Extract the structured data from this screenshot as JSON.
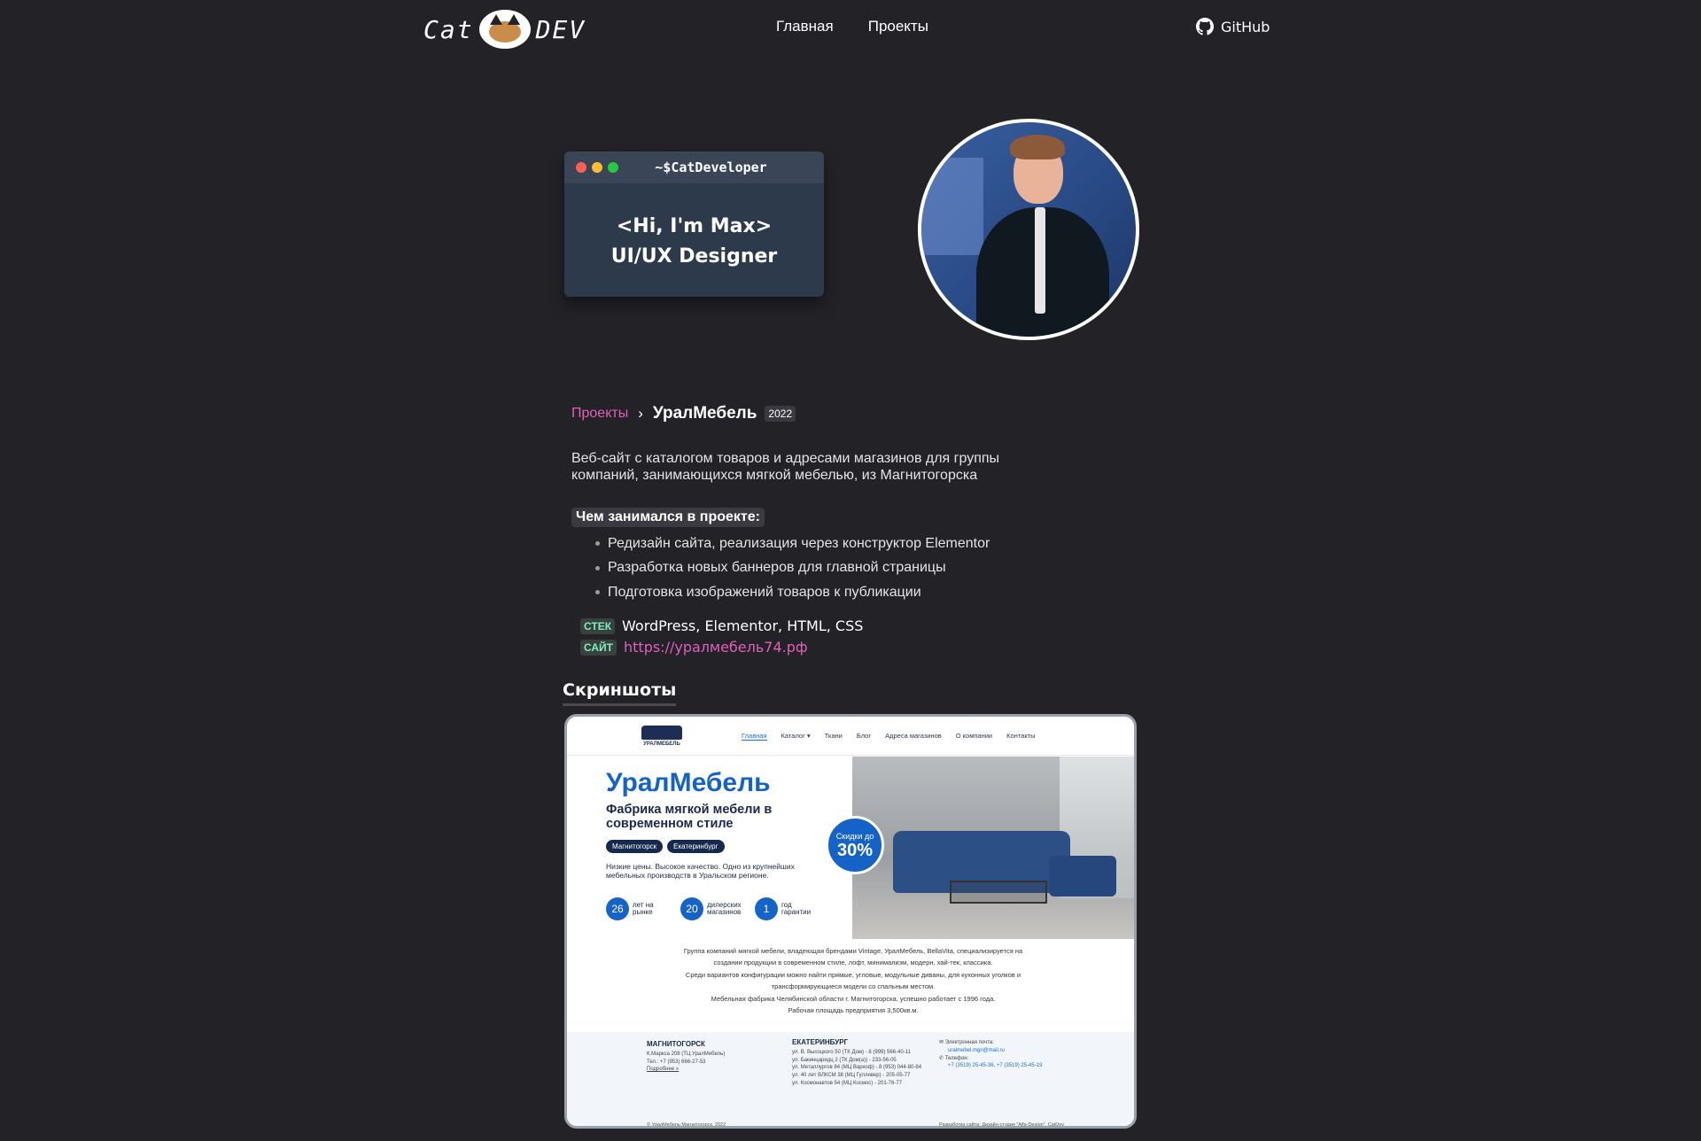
{
  "header": {
    "logo_left": "Cat",
    "logo_right": "DEV",
    "nav": [
      {
        "label": "Главная"
      },
      {
        "label": "Проекты"
      }
    ],
    "github_label": "GitHub"
  },
  "hero": {
    "terminal_title": "~$CatDeveloper",
    "greeting": "<Hi, I'm Max>",
    "role": "UI/UX Designer"
  },
  "project": {
    "breadcrumb_link": "Проекты",
    "breadcrumb_sep": "›",
    "title": "УралМебель",
    "year": "2022",
    "description": "Веб-сайт с каталогом товаров и адресами магазинов для группы компаний, занимающихся мягкой мебелью, из Магнитогорска",
    "role_heading": "Чем занимался в проекте:",
    "tasks": [
      "Редизайн сайта, реализация через конструктор Elementor",
      "Разработка новых баннеров для главной страницы",
      "Подготовка изображений товаров к публикации"
    ],
    "stack_tag": "СТЕК",
    "stack_value": "WordPress, Elementor, HTML, CSS",
    "site_tag": "САЙТ",
    "site_value": "https://уралмебель74.рф",
    "screenshots_heading": "Скриншоты"
  },
  "screenshot": {
    "logo_text": "УРАЛМЕБЕЛЬ",
    "nav": [
      "Главная",
      "Каталог ▾",
      "Ткани",
      "Блог",
      "Адреса магазинов",
      "О компании",
      "Контакты"
    ],
    "brand": "УралМебель",
    "tagline": "Фабрика мягкой мебели в современном стиле",
    "cities": [
      "Магнитогорск",
      "Екатеринбург"
    ],
    "subtitle": "Низкие цены. Высокое качество. Одно из крупнейших мебельных производств в Уральском регионе.",
    "stats": [
      {
        "num": "26",
        "label": "лет на рынке"
      },
      {
        "num": "20",
        "label": "дилерских магазинов"
      },
      {
        "num": "1",
        "label": "год гарантии"
      }
    ],
    "badge_top": "Скидки до",
    "badge_value": "30%",
    "about_lines": [
      "Группа компаний мягкой мебели, владеющая брендами Vintage, УралМебель, BellaVita, специализируется на",
      "создании продукции в современном стиле, лофт, минимализм, модерн, хай-тек, классика.",
      "Среди вариантов конфигурации можно найти прямые, угловые, модульные диваны, для кухонных уголков и",
      "трансформирующиеся модели со спальным местом.",
      "Мебельная фабрика Челябинской области г. Магнитогорска, успешно работает с 1996 года.",
      "Рабочая площадь предприятия 3,500кв.м."
    ],
    "footer_city1": "МАГНИТОГОРСК",
    "footer_city1_lines": [
      "К.Маркса 208 (ТЦ УралМебель)",
      "Тел.: +7 (953) 666-27-53",
      "",
      "Подробнее »"
    ],
    "footer_city2": "ЕКАТЕРИНБУРГ",
    "footer_city2_lines": [
      "ул. В. Высоцкого 50 (ТК Дом) - 8 (999) 566-40-11",
      "ул. Бакинцаридц 2 (ТК Дом(а)) - 233-56-05",
      "ул. Металлургов 84 (МЦ Вархоф) - 8 (953) 044-80-84",
      "ул. 40 лет ВЛКСМ 38 (МЦ Гулливер) - 205-05-77",
      "ул. Космонавтов 54 (МЦ Космос) - 201-76-77"
    ],
    "footer_email_label": "Электронная почта:",
    "footer_email": "uralmebel.mgn@mail.ru",
    "footer_phone_label": "Телефон:",
    "footer_phone": "+7 (3519) 25-45-36, +7 (3519) 25-45-19",
    "copyright": "© УралМебель Магнитогорск, 2022",
    "credits": "Разработка сайта: Дизайн-студия \"Alfa-Design\", CatDev"
  },
  "colors": {
    "page_bg": "#232226",
    "accent_pink": "#e05fbf",
    "tag_green": "#7ff0bd",
    "terminal_bg": "#2d3a4b",
    "shot_blue": "#1663c7"
  },
  "icons": {
    "github": "github-icon",
    "window_dots": [
      "close-dot",
      "minimize-dot",
      "maximize-dot"
    ]
  }
}
